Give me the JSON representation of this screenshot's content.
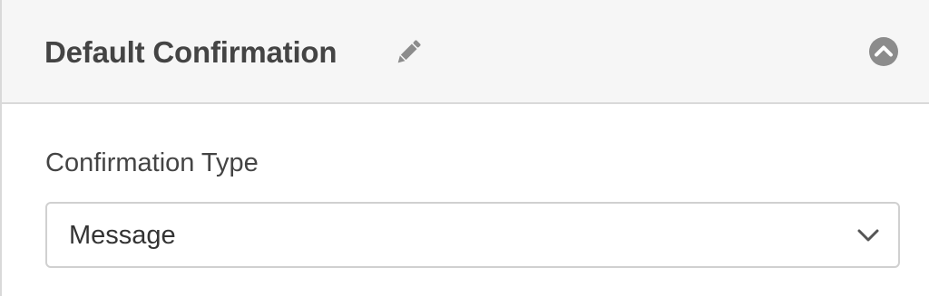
{
  "panel": {
    "title": "Default Confirmation",
    "edit_icon": "pencil-icon",
    "toggle_icon": "chevron-up-circle-icon"
  },
  "confirmation_type": {
    "label": "Confirmation Type",
    "selected": "Message",
    "dropdown_icon": "chevron-down-icon"
  },
  "colors": {
    "header_bg": "#f6f6f6",
    "text": "#444444",
    "icon": "#8c8c8c",
    "border": "#d0d0d0"
  }
}
